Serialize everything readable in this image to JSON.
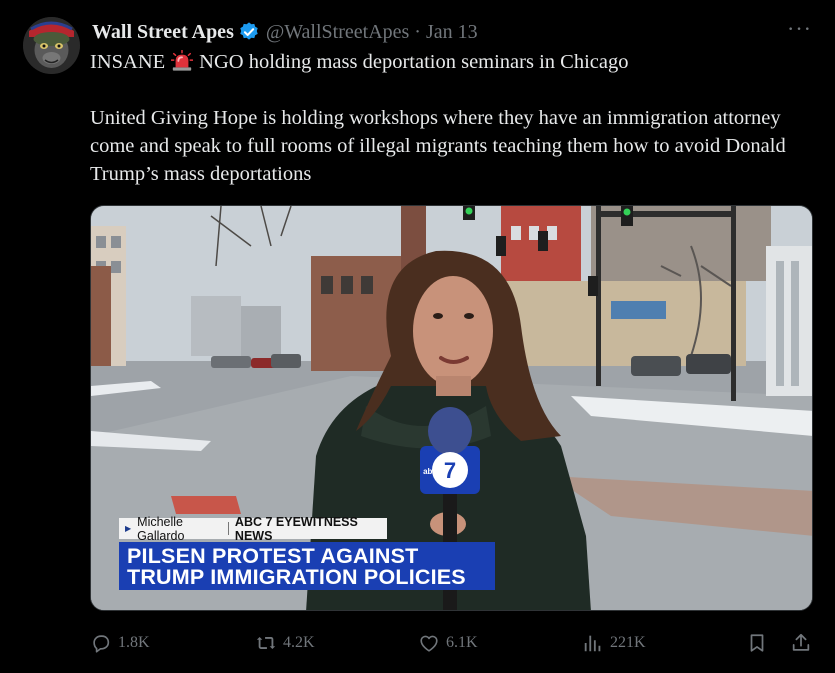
{
  "author": {
    "name": "Wall Street Apes",
    "handle": "@WallStreetApes",
    "separator": "·",
    "date": "Jan 13",
    "verified_color": "#1d9bf0"
  },
  "tweet": {
    "line1_before": "INSANE",
    "line1_after": "NGO holding mass deportation seminars in Chicago",
    "paragraph2": "United Giving Hope is holding workshops where they have an immigration attorney come and speak to full rooms of illegal migrants teaching them how to avoid Donald Trump’s mass deportations"
  },
  "media": {
    "lower_third_name": "Michelle Gallardo",
    "lower_third_station": "ABC 7 EYEWITNESS NEWS",
    "headline_line1": "PILSEN PROTEST AGAINST",
    "headline_line2": "TRUMP IMMIGRATION POLICIES",
    "mic_logo": "abc",
    "mic_number": "7",
    "accent_color": "#1a3fb3"
  },
  "actions": {
    "replies": "1.8K",
    "reposts": "4.2K",
    "likes": "6.1K",
    "views": "221K"
  },
  "icons": {
    "more": "more-icon",
    "siren": "police-light-emoji",
    "reply": "reply-icon",
    "repost": "repost-icon",
    "like": "heart-icon",
    "views": "views-icon",
    "bookmark": "bookmark-icon",
    "share": "share-icon"
  }
}
